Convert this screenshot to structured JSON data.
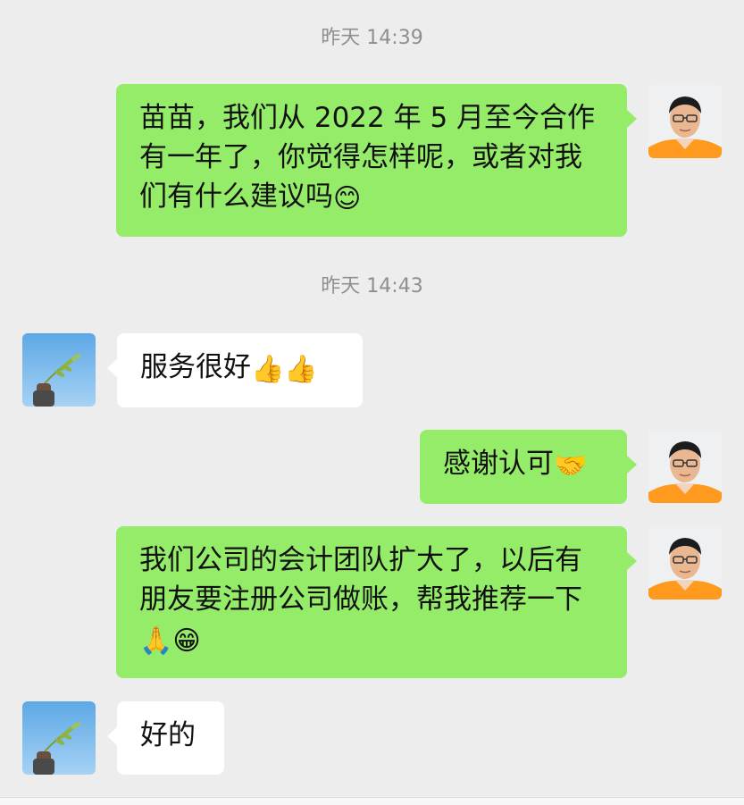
{
  "timestamps": [
    "昨天 14:39",
    "昨天 14:43"
  ],
  "messages": [
    {
      "side": "sent",
      "text": "苗苗，我们从 2022 年 5 月至今合作有一年了，你觉得怎样呢，或者对我们有什么建议吗",
      "emoji": "😊"
    },
    {
      "side": "recv",
      "text": "服务很好",
      "emoji": "👍👍"
    },
    {
      "side": "sent",
      "text": "感谢认可",
      "emoji": "🤝"
    },
    {
      "side": "sent",
      "text": "我们公司的会计团队扩大了，以后有朋友要注册公司做账，帮我推荐一下",
      "emoji": "🙏😁"
    },
    {
      "side": "recv",
      "text": "好的",
      "emoji": ""
    }
  ],
  "avatars": {
    "self": "person-avatar-icon",
    "contact": "wheat-sprig-avatar-icon"
  },
  "colors": {
    "background": "#ededed",
    "sent_bubble": "#95ec69",
    "received_bubble": "#ffffff",
    "timestamp": "#8f8f8f"
  }
}
